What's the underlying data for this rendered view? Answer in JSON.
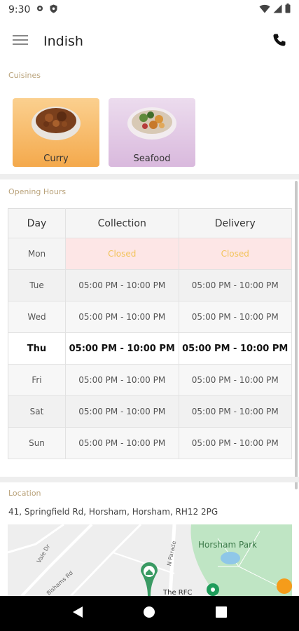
{
  "status": {
    "time": "9:30"
  },
  "app": {
    "title": "Indish"
  },
  "cuisines": {
    "label": "Cuisines",
    "items": [
      {
        "name": "Curry"
      },
      {
        "name": "Seafood"
      }
    ]
  },
  "hours": {
    "label": "Opening Hours",
    "headers": {
      "day": "Day",
      "collection": "Collection",
      "delivery": "Delivery"
    },
    "rows": [
      {
        "day": "Mon",
        "collection": "Closed",
        "delivery": "Closed"
      },
      {
        "day": "Tue",
        "collection": "05:00 PM - 10:00 PM",
        "delivery": "05:00 PM - 10:00 PM"
      },
      {
        "day": "Wed",
        "collection": "05:00 PM - 10:00 PM",
        "delivery": "05:00 PM - 10:00 PM"
      },
      {
        "day": "Thu",
        "collection": "05:00 PM - 10:00 PM",
        "delivery": "05:00 PM - 10:00 PM"
      },
      {
        "day": "Fri",
        "collection": "05:00 PM - 10:00 PM",
        "delivery": "05:00 PM - 10:00 PM"
      },
      {
        "day": "Sat",
        "collection": "05:00 PM - 10:00 PM",
        "delivery": "05:00 PM - 10:00 PM"
      },
      {
        "day": "Sun",
        "collection": "05:00 PM - 10:00 PM",
        "delivery": "05:00 PM - 10:00 PM"
      }
    ]
  },
  "location": {
    "label": "Location",
    "address": "41, Springfield Rd, Horsham, Horsham, RH12 2PG",
    "map_labels": {
      "park": "Horsham Park",
      "road1": "Vale Dr",
      "road2": "Bishams Rd",
      "road3": "N Parade",
      "poi": "The RFC"
    }
  },
  "icons": {
    "menu": "hamburger-icon",
    "phone": "phone-icon",
    "back": "nav-back-icon",
    "home": "nav-home-icon",
    "recents": "nav-recents-icon"
  }
}
